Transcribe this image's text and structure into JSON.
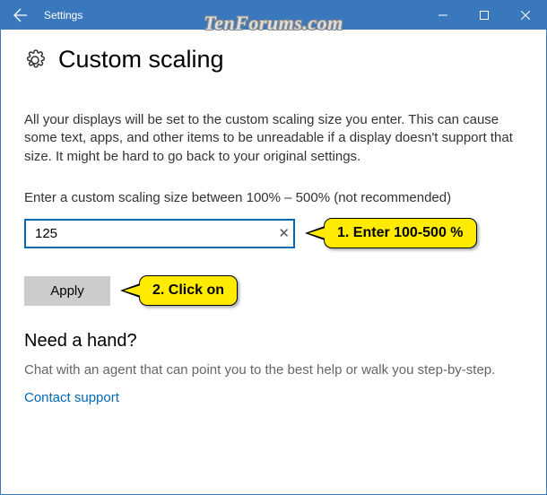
{
  "titlebar": {
    "title": "Settings"
  },
  "watermark": "TenForums.com",
  "page": {
    "title": "Custom scaling",
    "description": "All your displays will be set to the custom scaling size you enter. This can cause some text, apps, and other items to be unreadable if a display doesn't support that size. It might be hard to go back to your original settings.",
    "field_label": "Enter a custom scaling size between 100% – 500% (not recommended)",
    "input_value": "125",
    "apply_label": "Apply"
  },
  "callouts": {
    "c1": "1. Enter 100-500 %",
    "c2": "2. Click on"
  },
  "help": {
    "heading": "Need a hand?",
    "text": "Chat with an agent that can point you to the best help or walk you step-by-step.",
    "link": "Contact support"
  }
}
